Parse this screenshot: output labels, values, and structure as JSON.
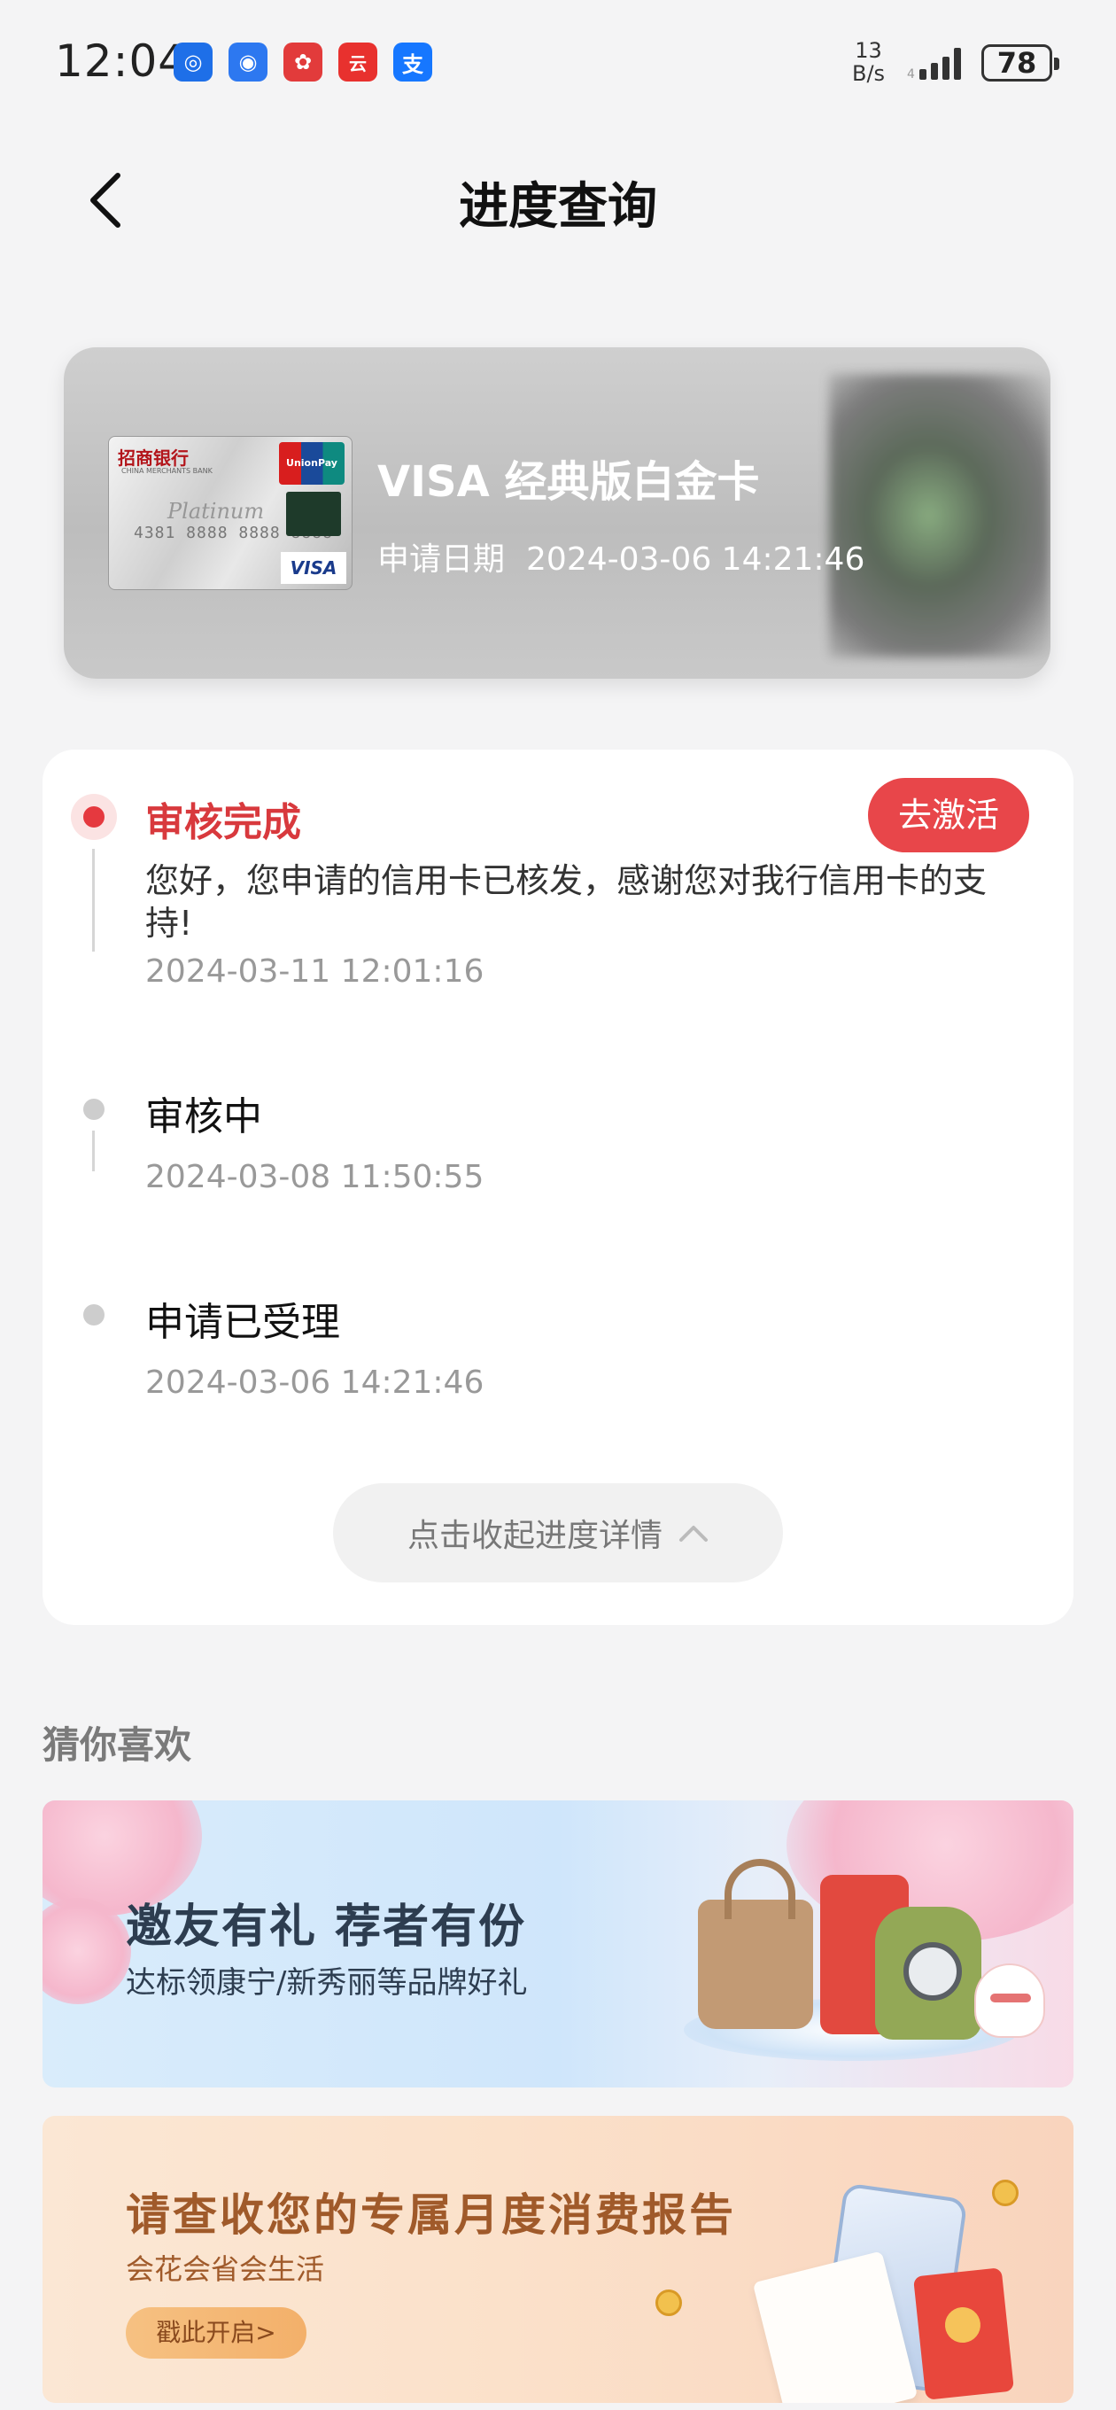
{
  "status_bar": {
    "time": "12:04",
    "net_speed_value": "13",
    "net_speed_unit": "B/s",
    "battery": "78",
    "app_icons": [
      {
        "icon": "blue-app-icon",
        "color": "#1e6fe8",
        "glyph": "◎"
      },
      {
        "icon": "blue-circle-app-icon",
        "color": "#2d78f0",
        "glyph": "◉"
      },
      {
        "icon": "red-flower-app-icon",
        "color": "#e23b3b",
        "glyph": "✿"
      },
      {
        "icon": "cloudpay-app-icon",
        "color": "#e8312e",
        "glyph": "云"
      },
      {
        "icon": "alipay-icon",
        "color": "#1677ff",
        "glyph": "支"
      }
    ]
  },
  "header": {
    "title": "进度查询",
    "back_icon": "chevron-left-icon"
  },
  "card": {
    "name": "VISA 经典版白金卡",
    "date_label": "申请日期",
    "date_value": "2024-03-06 14:21:46",
    "thumb": {
      "bank_name": "招商银行",
      "bank_name_en": "CHINA MERCHANTS BANK",
      "series": "Platinum",
      "number": "4381 8888 8888 8888",
      "network_badge": "UnionPay",
      "brand": "VISA"
    }
  },
  "progress": {
    "steps": [
      {
        "title": "审核完成",
        "description": "您好，您申请的信用卡已核发，感谢您对我行信用卡的支持!",
        "time": "2024-03-11 12:01:16",
        "active": true
      },
      {
        "title": "审核中",
        "time": "2024-03-08 11:50:55",
        "active": false
      },
      {
        "title": "申请已受理",
        "time": "2024-03-06 14:21:46",
        "active": false
      }
    ],
    "activate_label": "去激活",
    "collapse_label": "点击收起进度详情",
    "accent_color": "#e8464a"
  },
  "recommend": {
    "section_title": "猜你喜欢",
    "banners": [
      {
        "title": "邀友有礼  荐者有份",
        "subtitle": "达标领康宁/新秀丽等品牌好礼"
      },
      {
        "title": "请查收您的专属月度消费报告",
        "subtitle": "会花会省会生活",
        "button": "戳此开启>"
      }
    ]
  }
}
